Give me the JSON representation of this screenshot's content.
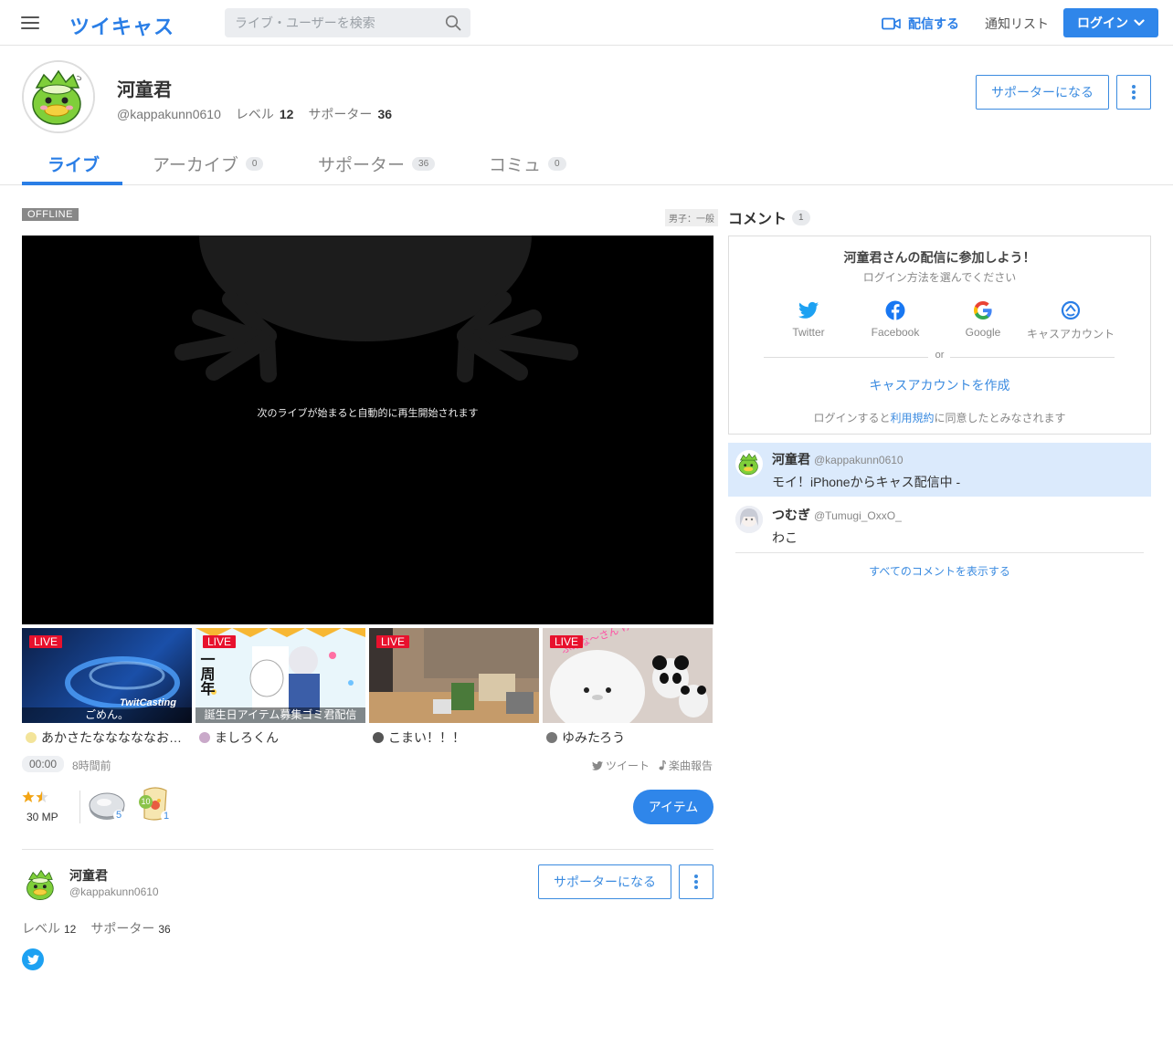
{
  "header": {
    "logo": "ツイキャス",
    "search_placeholder": "ライブ・ユーザーを検索",
    "broadcast_label": "配信する",
    "notification_label": "通知リスト",
    "login_label": "ログイン"
  },
  "profile": {
    "name": "河童君",
    "handle": "@kappakunn0610",
    "level_label": "レベル",
    "level": "12",
    "supporter_label": "サポーター",
    "supporters": "36",
    "become_supporter": "サポーターになる"
  },
  "tabs": [
    {
      "label": "ライブ",
      "count": ""
    },
    {
      "label": "アーカイブ",
      "count": "0"
    },
    {
      "label": "サポーター",
      "count": "36"
    },
    {
      "label": "コミュ",
      "count": "0"
    }
  ],
  "player": {
    "status": "OFFLINE",
    "category": "男子：一般",
    "message": "次のライブが始まると自動的に再生開始されます"
  },
  "live_thumbs": [
    {
      "badge": "LIVE",
      "caption": "ごめん。",
      "user": "あかさたなななななお…"
    },
    {
      "badge": "LIVE",
      "caption": "誕生日アイテム募集ゴミ君配信",
      "user": "ましろくん",
      "overlay": "一周年"
    },
    {
      "badge": "LIVE",
      "caption": "",
      "user": "こまい！！！"
    },
    {
      "badge": "LIVE",
      "caption": "",
      "user": "ゆみたろう",
      "overlay": "ふみな～さん けらっしゃい"
    }
  ],
  "thumb_logo": "TwitCasting",
  "stats": {
    "time": "00:00",
    "ago": "8時間前",
    "tweet": "ツイート",
    "song_report": "楽曲報告",
    "mp": "30 MP",
    "rating": 1.5,
    "item1_count": "5",
    "item2_count": "1",
    "item2_badge": "10",
    "item_button": "アイテム"
  },
  "bottom_profile": {
    "name": "河童君",
    "handle": "@kappakunn0610",
    "level_label": "レベル",
    "level": "12",
    "supporter_label": "サポーター",
    "supporters": "36",
    "become_supporter": "サポーターになる"
  },
  "comments": {
    "title": "コメント",
    "count": "1",
    "login_title": "河童君さんの配信に参加しよう！",
    "login_sub": "ログイン方法を選んでください",
    "providers": [
      "Twitter",
      "Facebook",
      "Google",
      "キャスアカウント"
    ],
    "or": "or",
    "create_account": "キャスアカウントを作成",
    "terms_prefix": "ログインすると",
    "terms_link": "利用規約",
    "terms_suffix": "に同意したとみなされます",
    "items": [
      {
        "name": "河童君",
        "handle": "@kappakunn0610",
        "text": "モイ！iPhoneからキャス配信中 -"
      },
      {
        "name": "つむぎ",
        "handle": "@Tumugi_OxxO_",
        "text": "わこ"
      }
    ],
    "show_all": "すべてのコメントを表示する"
  },
  "colors": {
    "brand": "#2a7ee6",
    "live": "#e8112d",
    "twitter": "#1da1f2",
    "facebook": "#1877f2"
  }
}
